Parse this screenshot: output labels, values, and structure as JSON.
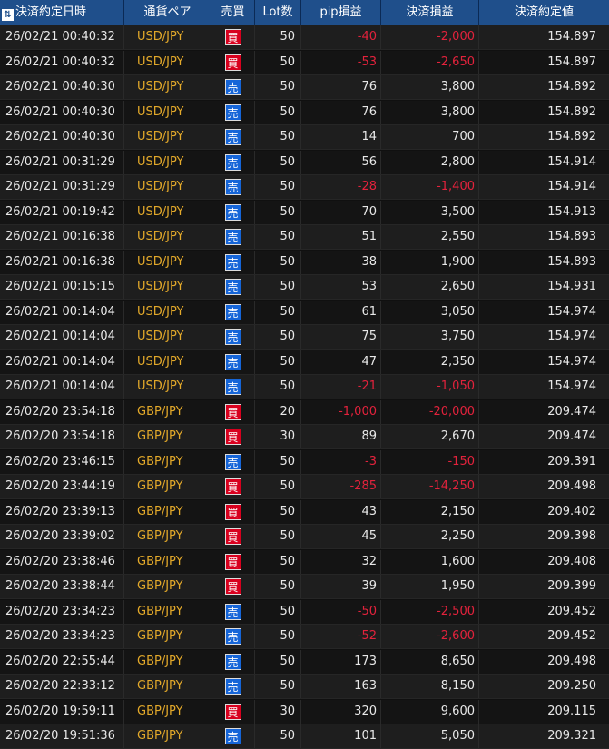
{
  "header": {
    "sort_icon": "⇅",
    "columns": [
      "決済約定日時",
      "通貨ペア",
      "売買",
      "Lot数",
      "pip損益",
      "決済損益",
      "決済約定値"
    ]
  },
  "colors": {
    "buy": "#d8001e",
    "sell": "#1565d8",
    "negative": "#e3223c",
    "pair": "#e3a92a",
    "header": "#1f4f8b"
  },
  "rows": [
    {
      "time": "26/02/21 00:40:32",
      "pair": "USD/JPY",
      "side": "買",
      "side_type": "buy",
      "lot": "50",
      "pip": "-40",
      "pl": "-2,000",
      "price": "154.897"
    },
    {
      "time": "26/02/21 00:40:32",
      "pair": "USD/JPY",
      "side": "買",
      "side_type": "buy",
      "lot": "50",
      "pip": "-53",
      "pl": "-2,650",
      "price": "154.897"
    },
    {
      "time": "26/02/21 00:40:30",
      "pair": "USD/JPY",
      "side": "売",
      "side_type": "sell",
      "lot": "50",
      "pip": "76",
      "pl": "3,800",
      "price": "154.892"
    },
    {
      "time": "26/02/21 00:40:30",
      "pair": "USD/JPY",
      "side": "売",
      "side_type": "sell",
      "lot": "50",
      "pip": "76",
      "pl": "3,800",
      "price": "154.892"
    },
    {
      "time": "26/02/21 00:40:30",
      "pair": "USD/JPY",
      "side": "売",
      "side_type": "sell",
      "lot": "50",
      "pip": "14",
      "pl": "700",
      "price": "154.892"
    },
    {
      "time": "26/02/21 00:31:29",
      "pair": "USD/JPY",
      "side": "売",
      "side_type": "sell",
      "lot": "50",
      "pip": "56",
      "pl": "2,800",
      "price": "154.914"
    },
    {
      "time": "26/02/21 00:31:29",
      "pair": "USD/JPY",
      "side": "売",
      "side_type": "sell",
      "lot": "50",
      "pip": "-28",
      "pl": "-1,400",
      "price": "154.914"
    },
    {
      "time": "26/02/21 00:19:42",
      "pair": "USD/JPY",
      "side": "売",
      "side_type": "sell",
      "lot": "50",
      "pip": "70",
      "pl": "3,500",
      "price": "154.913"
    },
    {
      "time": "26/02/21 00:16:38",
      "pair": "USD/JPY",
      "side": "売",
      "side_type": "sell",
      "lot": "50",
      "pip": "51",
      "pl": "2,550",
      "price": "154.893"
    },
    {
      "time": "26/02/21 00:16:38",
      "pair": "USD/JPY",
      "side": "売",
      "side_type": "sell",
      "lot": "50",
      "pip": "38",
      "pl": "1,900",
      "price": "154.893"
    },
    {
      "time": "26/02/21 00:15:15",
      "pair": "USD/JPY",
      "side": "売",
      "side_type": "sell",
      "lot": "50",
      "pip": "53",
      "pl": "2,650",
      "price": "154.931"
    },
    {
      "time": "26/02/21 00:14:04",
      "pair": "USD/JPY",
      "side": "売",
      "side_type": "sell",
      "lot": "50",
      "pip": "61",
      "pl": "3,050",
      "price": "154.974"
    },
    {
      "time": "26/02/21 00:14:04",
      "pair": "USD/JPY",
      "side": "売",
      "side_type": "sell",
      "lot": "50",
      "pip": "75",
      "pl": "3,750",
      "price": "154.974"
    },
    {
      "time": "26/02/21 00:14:04",
      "pair": "USD/JPY",
      "side": "売",
      "side_type": "sell",
      "lot": "50",
      "pip": "47",
      "pl": "2,350",
      "price": "154.974"
    },
    {
      "time": "26/02/21 00:14:04",
      "pair": "USD/JPY",
      "side": "売",
      "side_type": "sell",
      "lot": "50",
      "pip": "-21",
      "pl": "-1,050",
      "price": "154.974"
    },
    {
      "time": "26/02/20 23:54:18",
      "pair": "GBP/JPY",
      "side": "買",
      "side_type": "buy",
      "lot": "20",
      "pip": "-1,000",
      "pl": "-20,000",
      "price": "209.474"
    },
    {
      "time": "26/02/20 23:54:18",
      "pair": "GBP/JPY",
      "side": "買",
      "side_type": "buy",
      "lot": "30",
      "pip": "89",
      "pl": "2,670",
      "price": "209.474"
    },
    {
      "time": "26/02/20 23:46:15",
      "pair": "GBP/JPY",
      "side": "売",
      "side_type": "sell",
      "lot": "50",
      "pip": "-3",
      "pl": "-150",
      "price": "209.391"
    },
    {
      "time": "26/02/20 23:44:19",
      "pair": "GBP/JPY",
      "side": "買",
      "side_type": "buy",
      "lot": "50",
      "pip": "-285",
      "pl": "-14,250",
      "price": "209.498"
    },
    {
      "time": "26/02/20 23:39:13",
      "pair": "GBP/JPY",
      "side": "買",
      "side_type": "buy",
      "lot": "50",
      "pip": "43",
      "pl": "2,150",
      "price": "209.402"
    },
    {
      "time": "26/02/20 23:39:02",
      "pair": "GBP/JPY",
      "side": "買",
      "side_type": "buy",
      "lot": "50",
      "pip": "45",
      "pl": "2,250",
      "price": "209.398"
    },
    {
      "time": "26/02/20 23:38:46",
      "pair": "GBP/JPY",
      "side": "買",
      "side_type": "buy",
      "lot": "50",
      "pip": "32",
      "pl": "1,600",
      "price": "209.408"
    },
    {
      "time": "26/02/20 23:38:44",
      "pair": "GBP/JPY",
      "side": "買",
      "side_type": "buy",
      "lot": "50",
      "pip": "39",
      "pl": "1,950",
      "price": "209.399"
    },
    {
      "time": "26/02/20 23:34:23",
      "pair": "GBP/JPY",
      "side": "売",
      "side_type": "sell",
      "lot": "50",
      "pip": "-50",
      "pl": "-2,500",
      "price": "209.452"
    },
    {
      "time": "26/02/20 23:34:23",
      "pair": "GBP/JPY",
      "side": "売",
      "side_type": "sell",
      "lot": "50",
      "pip": "-52",
      "pl": "-2,600",
      "price": "209.452"
    },
    {
      "time": "26/02/20 22:55:44",
      "pair": "GBP/JPY",
      "side": "売",
      "side_type": "sell",
      "lot": "50",
      "pip": "173",
      "pl": "8,650",
      "price": "209.498"
    },
    {
      "time": "26/02/20 22:33:12",
      "pair": "GBP/JPY",
      "side": "売",
      "side_type": "sell",
      "lot": "50",
      "pip": "163",
      "pl": "8,150",
      "price": "209.250"
    },
    {
      "time": "26/02/20 19:59:11",
      "pair": "GBP/JPY",
      "side": "買",
      "side_type": "buy",
      "lot": "30",
      "pip": "320",
      "pl": "9,600",
      "price": "209.115"
    },
    {
      "time": "26/02/20 19:51:36",
      "pair": "GBP/JPY",
      "side": "売",
      "side_type": "sell",
      "lot": "50",
      "pip": "101",
      "pl": "5,050",
      "price": "209.321"
    }
  ]
}
